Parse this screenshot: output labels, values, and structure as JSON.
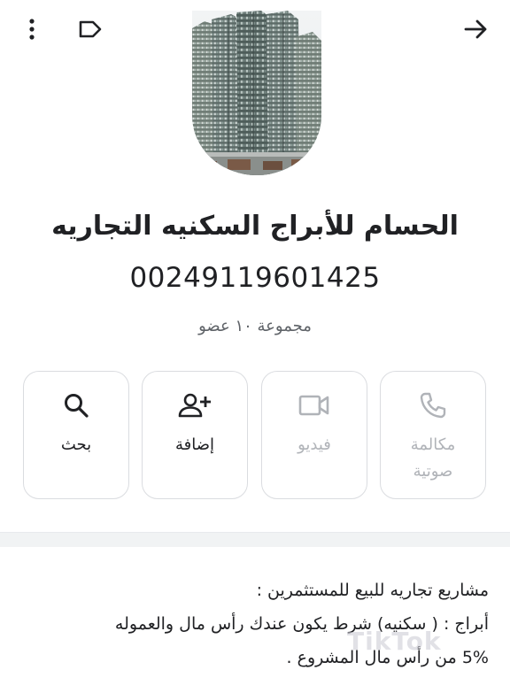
{
  "header": {
    "more_icon": "more-vert-icon",
    "label_icon": "label-icon",
    "back_icon": "arrow-forward-icon"
  },
  "group": {
    "name": "الحسام للأبراج السكنيه التجاريه",
    "phone": "00249119601425",
    "members": "مجموعة ١٠ عضو"
  },
  "actions": {
    "search": "بحث",
    "add": "إضافة",
    "video": "فيديو",
    "call_line1": "مكالمة",
    "call_line2": "صوتية"
  },
  "description": {
    "line1": "مشاريع تجاريه للبيع للمستثمرين :",
    "line2": "أبراج : ( سكنيه)  شرط يكون عندك رأس مال والعموله",
    "line3": "5% من رأس مال المشروع ."
  },
  "watermark": "TikTok",
  "colors": {
    "disabled": "#b0b3b8",
    "border": "#dadce0",
    "text": "#202124"
  }
}
